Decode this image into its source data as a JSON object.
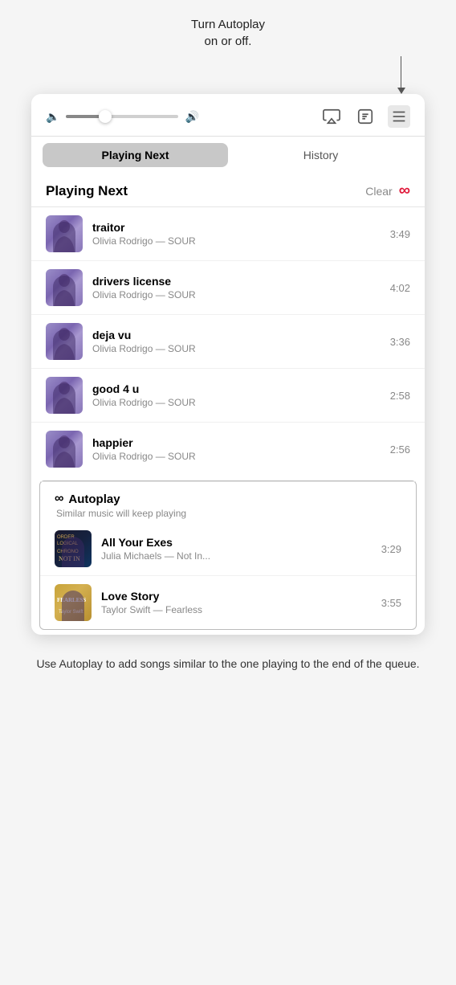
{
  "tooltip": {
    "text": "Turn Autoplay\non or off."
  },
  "controls": {
    "volume_min_icon": "🔈",
    "volume_max_icon": "🔊",
    "airplay_icon": "⍋",
    "lyrics_icon": "❝",
    "queue_icon": "☰"
  },
  "tabs": [
    {
      "label": "Playing Next",
      "active": true
    },
    {
      "label": "History",
      "active": false
    }
  ],
  "playing_next": {
    "title": "Playing Next",
    "clear_label": "Clear"
  },
  "tracks": [
    {
      "name": "traitor",
      "artist": "Olivia Rodrigo",
      "album": "SOUR",
      "duration": "3:49",
      "type": "sour"
    },
    {
      "name": "drivers license",
      "artist": "Olivia Rodrigo",
      "album": "SOUR",
      "duration": "4:02",
      "type": "sour"
    },
    {
      "name": "deja vu",
      "artist": "Olivia Rodrigo",
      "album": "SOUR",
      "duration": "3:36",
      "type": "sour"
    },
    {
      "name": "good 4 u",
      "artist": "Olivia Rodrigo",
      "album": "SOUR",
      "duration": "2:58",
      "type": "sour"
    },
    {
      "name": "happier",
      "artist": "Olivia Rodrigo",
      "album": "SOUR",
      "duration": "2:56",
      "type": "sour"
    }
  ],
  "autoplay": {
    "title": "Autoplay",
    "subtitle": "Similar music will keep playing",
    "icon": "∞"
  },
  "autoplay_tracks": [
    {
      "name": "All Your Exes",
      "artist": "Julia Michaels",
      "album": "Not In...",
      "duration": "3:29",
      "type": "allexes"
    },
    {
      "name": "Love Story",
      "artist": "Taylor Swift",
      "album": "Fearless",
      "duration": "3:55",
      "type": "lovestory"
    }
  ],
  "bottom_note": "Use Autoplay to add songs similar to the\none playing to the end of the queue."
}
